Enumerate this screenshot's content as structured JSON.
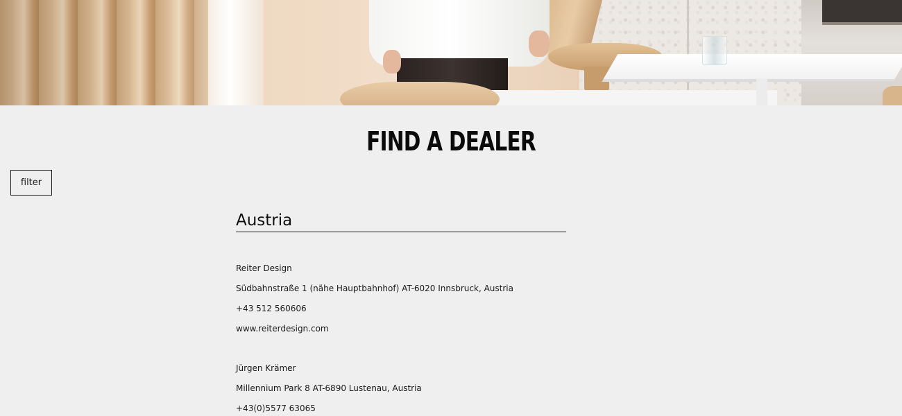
{
  "page": {
    "title": "FIND A DEALER",
    "filter_label": "filter"
  },
  "hero": {
    "image_alt": "showroom scene with person, wooden chairs and white table"
  },
  "countries": [
    {
      "name": "Austria",
      "dealers": [
        {
          "name": "Reiter Design",
          "address": "Südbahnstraße 1 (nähe Hauptbahnhof) AT-6020 Innsbruck, Austria",
          "phone": "+43 512 560606",
          "website": "www.reiterdesign.com"
        },
        {
          "name": "Jürgen Krämer",
          "address": "Millennium Park 8 AT-6890 Lustenau, Austria",
          "phone": "+43(0)5577 63065"
        }
      ]
    }
  ],
  "colors": {
    "background": "#efefef",
    "text": "#111111",
    "border": "#1a1a1a"
  }
}
